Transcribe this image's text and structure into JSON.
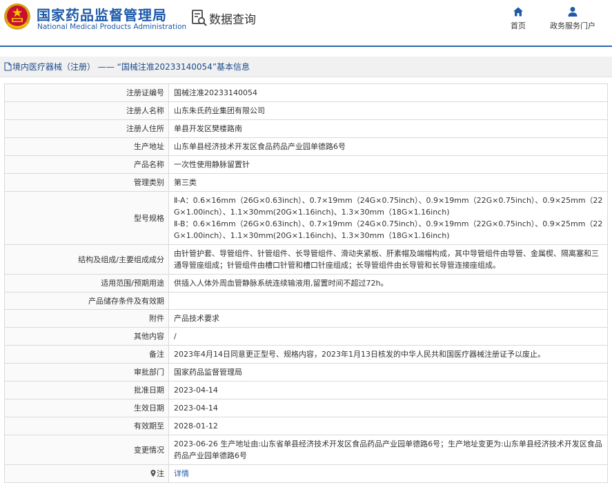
{
  "header": {
    "brand_cn": "国家药品监督管理局",
    "brand_en": "National Medical Products Administration",
    "data_query_label": "数据查询",
    "nav_home_label": "首页",
    "nav_portal_label": "政务服务门户",
    "accent_color": "#1e5aa8"
  },
  "breadcrumb": {
    "text": "境内医疗器械（注册） —— “国械注准20233140054”基本信息"
  },
  "fields": {
    "reg_no": {
      "label": "注册证编号",
      "value": "国械注准20233140054"
    },
    "registrant_name": {
      "label": "注册人名称",
      "value": "山东朱氏药业集团有限公司"
    },
    "registrant_address": {
      "label": "注册人住所",
      "value": "单县开发区樊楼路南"
    },
    "production_address": {
      "label": "生产地址",
      "value": "山东单县经济技术开发区食品药品产业园单德路6号"
    },
    "product_name": {
      "label": "产品名称",
      "value": "一次性使用静脉留置针"
    },
    "category": {
      "label": "管理类别",
      "value": "第三类"
    },
    "model_spec": {
      "label": "型号规格",
      "lines": [
        "Ⅱ-A：0.6×16mm（26G×0.63inch）、0.7×19mm（24G×0.75inch）、0.9×19mm（22G×0.75inch）、0.9×25mm（22G×1.00inch）、1.1×30mm(20G×1.16inch)、1.3×30mm（18G×1.16inch)",
        "Ⅱ-B：0.6×16mm（26G×0.63inch）、0.7×19mm（24G×0.75inch）、0.9×19mm（22G×0.75inch）、0.9×25mm（22G×1.00inch）、1.1×30mm(20G×1.16inch)、1.3×30mm（18G×1.16inch)"
      ]
    },
    "structure": {
      "label": "结构及组成/主要组成成分",
      "value": "由针管护套、导管组件、针管组件、长导管组件、滑动夹紧板、肝素帽及端帽构成，其中导管组件由导管、金属楔、隔离塞和三通导管座组成；针管组件由槽口针管和槽口针座组成；长导管组件由长导管和长导管连接座组成。"
    },
    "scope": {
      "label": "适用范围/预期用途",
      "value": "供插入人体外周血管静脉系统连续输液用,留置时间不超过72h。"
    },
    "storage": {
      "label": "产品储存条件及有效期",
      "value": ""
    },
    "attachment": {
      "label": "附件",
      "value": "产品技术要求"
    },
    "other": {
      "label": "其他内容",
      "value": "/"
    },
    "remark": {
      "label": "备注",
      "value": "2023年4月14日同意更正型号、规格内容，2023年1月13日核发的中华人民共和国医疗器械注册证予以废止。"
    },
    "approval_dept": {
      "label": "审批部门",
      "value": "国家药品监督管理局"
    },
    "approval_date": {
      "label": "批准日期",
      "value": "2023-04-14"
    },
    "effective_date": {
      "label": "生效日期",
      "value": "2023-04-14"
    },
    "valid_until": {
      "label": "有效期至",
      "value": "2028-01-12"
    },
    "changes": {
      "label": "变更情况",
      "value": "2023-06-26 生产地址由:山东省单县经济技术开发区食品药品产业园单德路6号；生产地址变更为:山东单县经济技术开发区食品药品产业园单德路6号"
    },
    "note": {
      "label": "注",
      "link": "详情"
    }
  }
}
